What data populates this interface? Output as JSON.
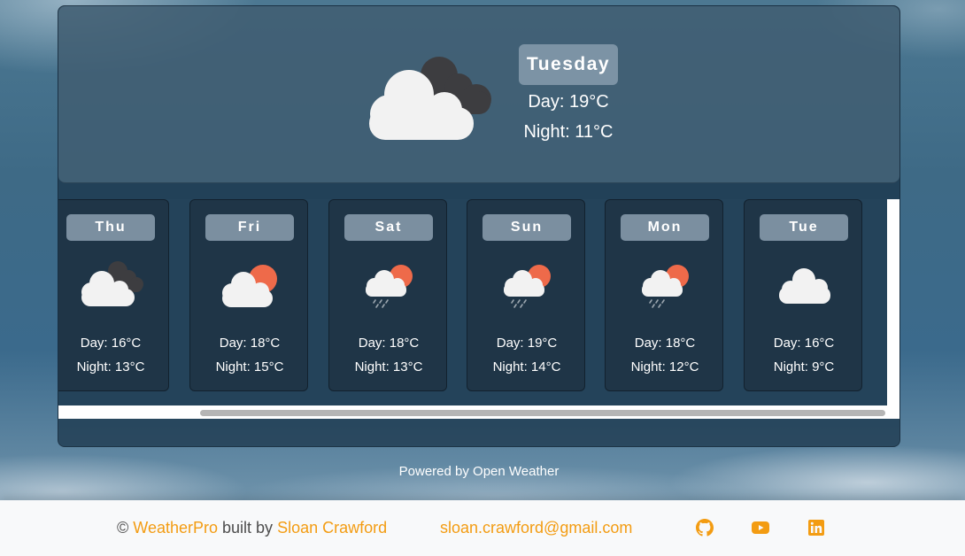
{
  "today": {
    "day_label": "Tuesday",
    "day_temp": "Day: 19°C",
    "night_temp": "Night: 11°C",
    "icon": "cloudy-icon"
  },
  "forecast": [
    {
      "label": "Thu",
      "day_temp": "Day: 16°C",
      "night_temp": "Night: 13°C",
      "icon": "cloudy-icon"
    },
    {
      "label": "Fri",
      "day_temp": "Day: 18°C",
      "night_temp": "Night: 15°C",
      "icon": "partly-sunny-icon"
    },
    {
      "label": "Sat",
      "day_temp": "Day: 18°C",
      "night_temp": "Night: 13°C",
      "icon": "sun-rain-icon"
    },
    {
      "label": "Sun",
      "day_temp": "Day: 19°C",
      "night_temp": "Night: 14°C",
      "icon": "sun-rain-icon"
    },
    {
      "label": "Mon",
      "day_temp": "Day: 18°C",
      "night_temp": "Night: 12°C",
      "icon": "sun-rain-icon"
    },
    {
      "label": "Tue",
      "day_temp": "Day: 16°C",
      "night_temp": "Night: 9°C",
      "icon": "cloud-icon"
    }
  ],
  "powered_by": "Powered by Open Weather",
  "footer": {
    "copyright": "©",
    "app_name": "WeatherPro",
    "built_by": "built by",
    "author": "Sloan Crawford",
    "email": "sloan.crawford@gmail.com",
    "social_icons": [
      "github-icon",
      "youtube-icon",
      "linkedin-icon"
    ]
  },
  "colors": {
    "accent": "#f39c12",
    "sun": "#ee6a4a",
    "cloud": "#f2f2f2",
    "dark_cloud": "#3d3d40"
  }
}
